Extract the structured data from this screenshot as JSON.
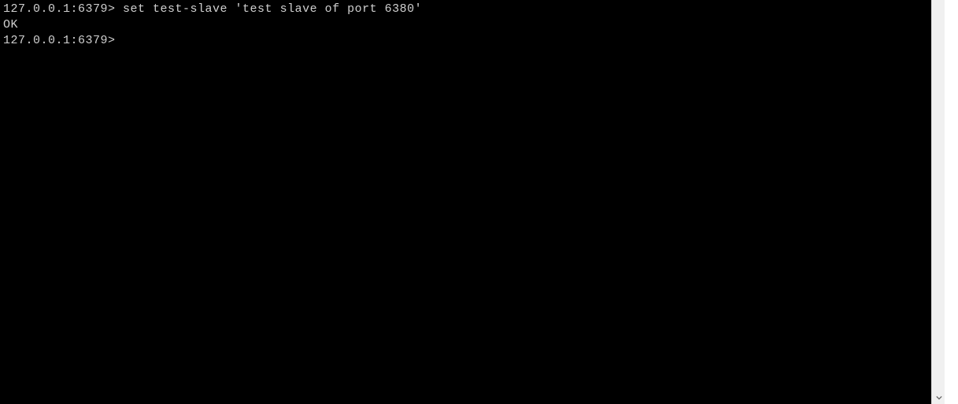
{
  "terminal": {
    "lines": [
      {
        "prompt": "127.0.0.1:6379>",
        "command": " set test-slave 'test slave of port 6380'"
      },
      {
        "output": "OK"
      },
      {
        "prompt": "127.0.0.1:6379>",
        "command": ""
      }
    ]
  }
}
